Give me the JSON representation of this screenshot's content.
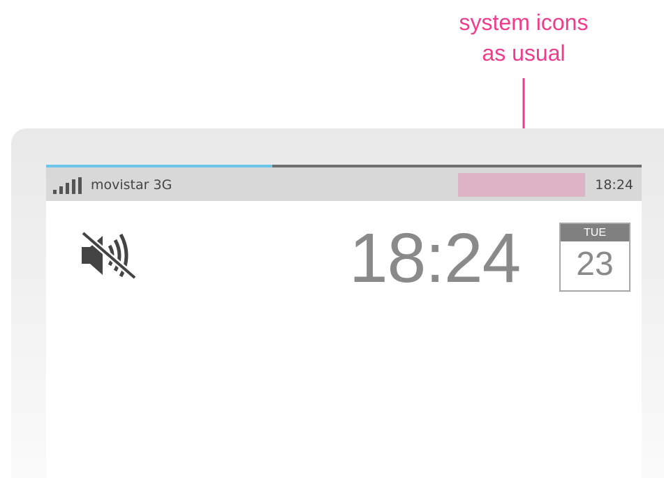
{
  "annotation": {
    "line1": "system icons",
    "line2": "as usual",
    "color": "#ef3d8e"
  },
  "status_bar": {
    "signal_icon": "signal-strength-icon",
    "carrier": "movistar 3G",
    "time": "18:24",
    "system_icons_placeholder_color": "#dfb3c6"
  },
  "progress": {
    "fraction": 0.38,
    "fill_color": "#6ec6ea",
    "track_color": "#6f6f6f"
  },
  "lockscreen": {
    "mute_icon": "sound-muted-icon",
    "clock": "18:24",
    "calendar": {
      "day": "TUE",
      "date": "23"
    }
  }
}
